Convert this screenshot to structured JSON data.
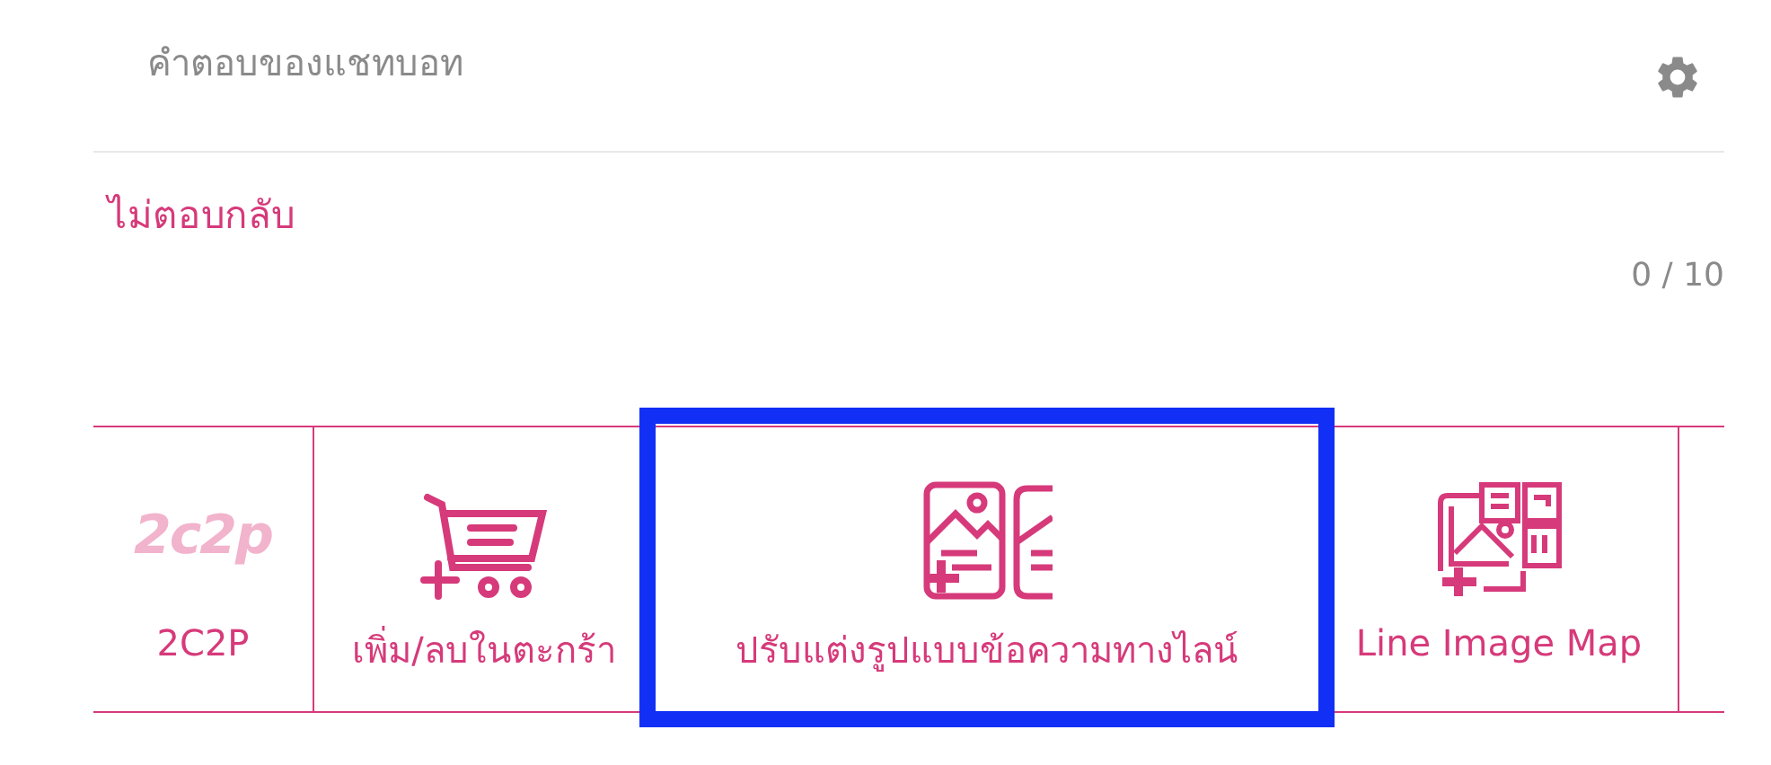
{
  "header": {
    "title": "คำตอบของแชทบอท"
  },
  "reply": {
    "value": "ไม่ตอบกลับ",
    "counter": "0 / 10"
  },
  "actions": [
    {
      "kind": "logo",
      "logo": "2c2p",
      "label": "2C2P",
      "highlighted": false
    },
    {
      "kind": "cart",
      "label": "เพิ่ม/ลบในตะกร้า",
      "highlighted": false
    },
    {
      "kind": "flex",
      "label": "ปรับแต่งรูปแบบข้อความทางไลน์",
      "highlighted": true
    },
    {
      "kind": "imagemap",
      "label": "Line Image Map",
      "highlighted": false
    },
    {
      "kind": "empty"
    }
  ]
}
